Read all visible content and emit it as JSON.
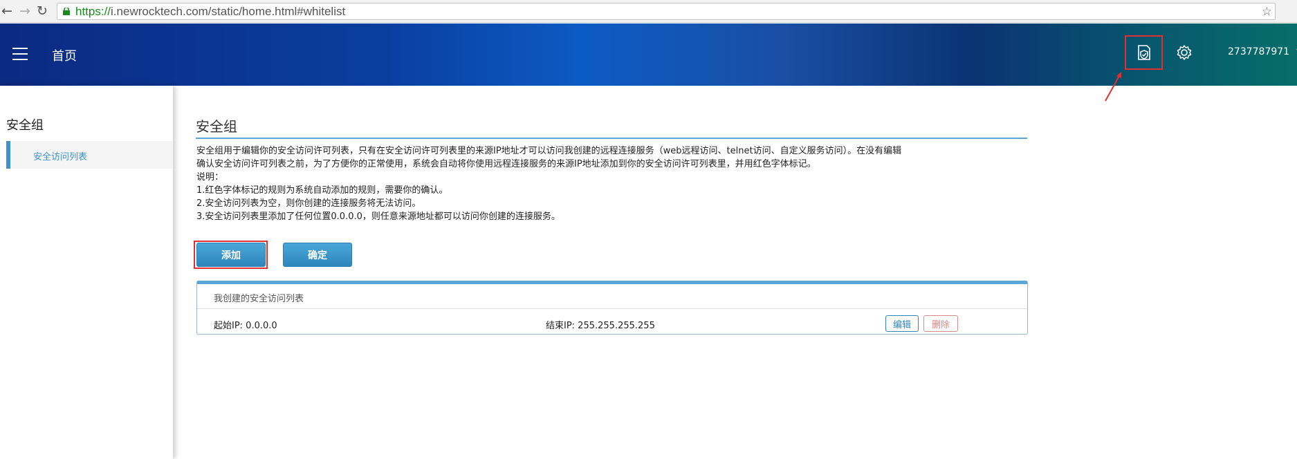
{
  "browser": {
    "url_scheme": "https://",
    "url_rest": "i.newrocktech.com/static/home.html#whitelist"
  },
  "header": {
    "title": "首页",
    "user": "2737787971"
  },
  "sidebar": {
    "title": "安全组",
    "items": [
      {
        "label": "安全访问列表"
      }
    ]
  },
  "main": {
    "title": "安全组",
    "description": [
      "安全组用于编辑你的安全访问许可列表，只有在安全访问许可列表里的来源IP地址才可以访问我创建的远程连接服务（web远程访问、telnet访问、自定义服务访问）。在没有编辑",
      "确认安全访问许可列表之前，为了方便你的正常使用，系统会自动将你使用远程连接服务的来源IP地址添加到你的安全访问许可列表里，并用红色字体标记。",
      "说明：",
      "1.红色字体标记的规则为系统自动添加的规则，需要你的确认。",
      "2.安全访问列表为空，则你创建的连接服务将无法访问。",
      "3.安全访问列表里添加了任何位置0.0.0.0，则任意来源地址都可以访问你创建的连接服务。"
    ],
    "add_label": "添加",
    "ok_label": "确定",
    "panel": {
      "heading": "我创建的安全访问列表",
      "rows": [
        {
          "start_ip": "起始IP: 0.0.0.0",
          "end_ip": "结束IP: 255.255.255.255",
          "edit_label": "编辑",
          "delete_label": "删除"
        }
      ]
    }
  },
  "colors": {
    "accent": "#3b93c8",
    "highlight": "#e03030"
  },
  "icons": [
    "back-icon",
    "forward-icon",
    "reload-icon",
    "lock-icon",
    "hamburger-icon",
    "shield-icon",
    "gear-icon",
    "caret-down-icon"
  ]
}
